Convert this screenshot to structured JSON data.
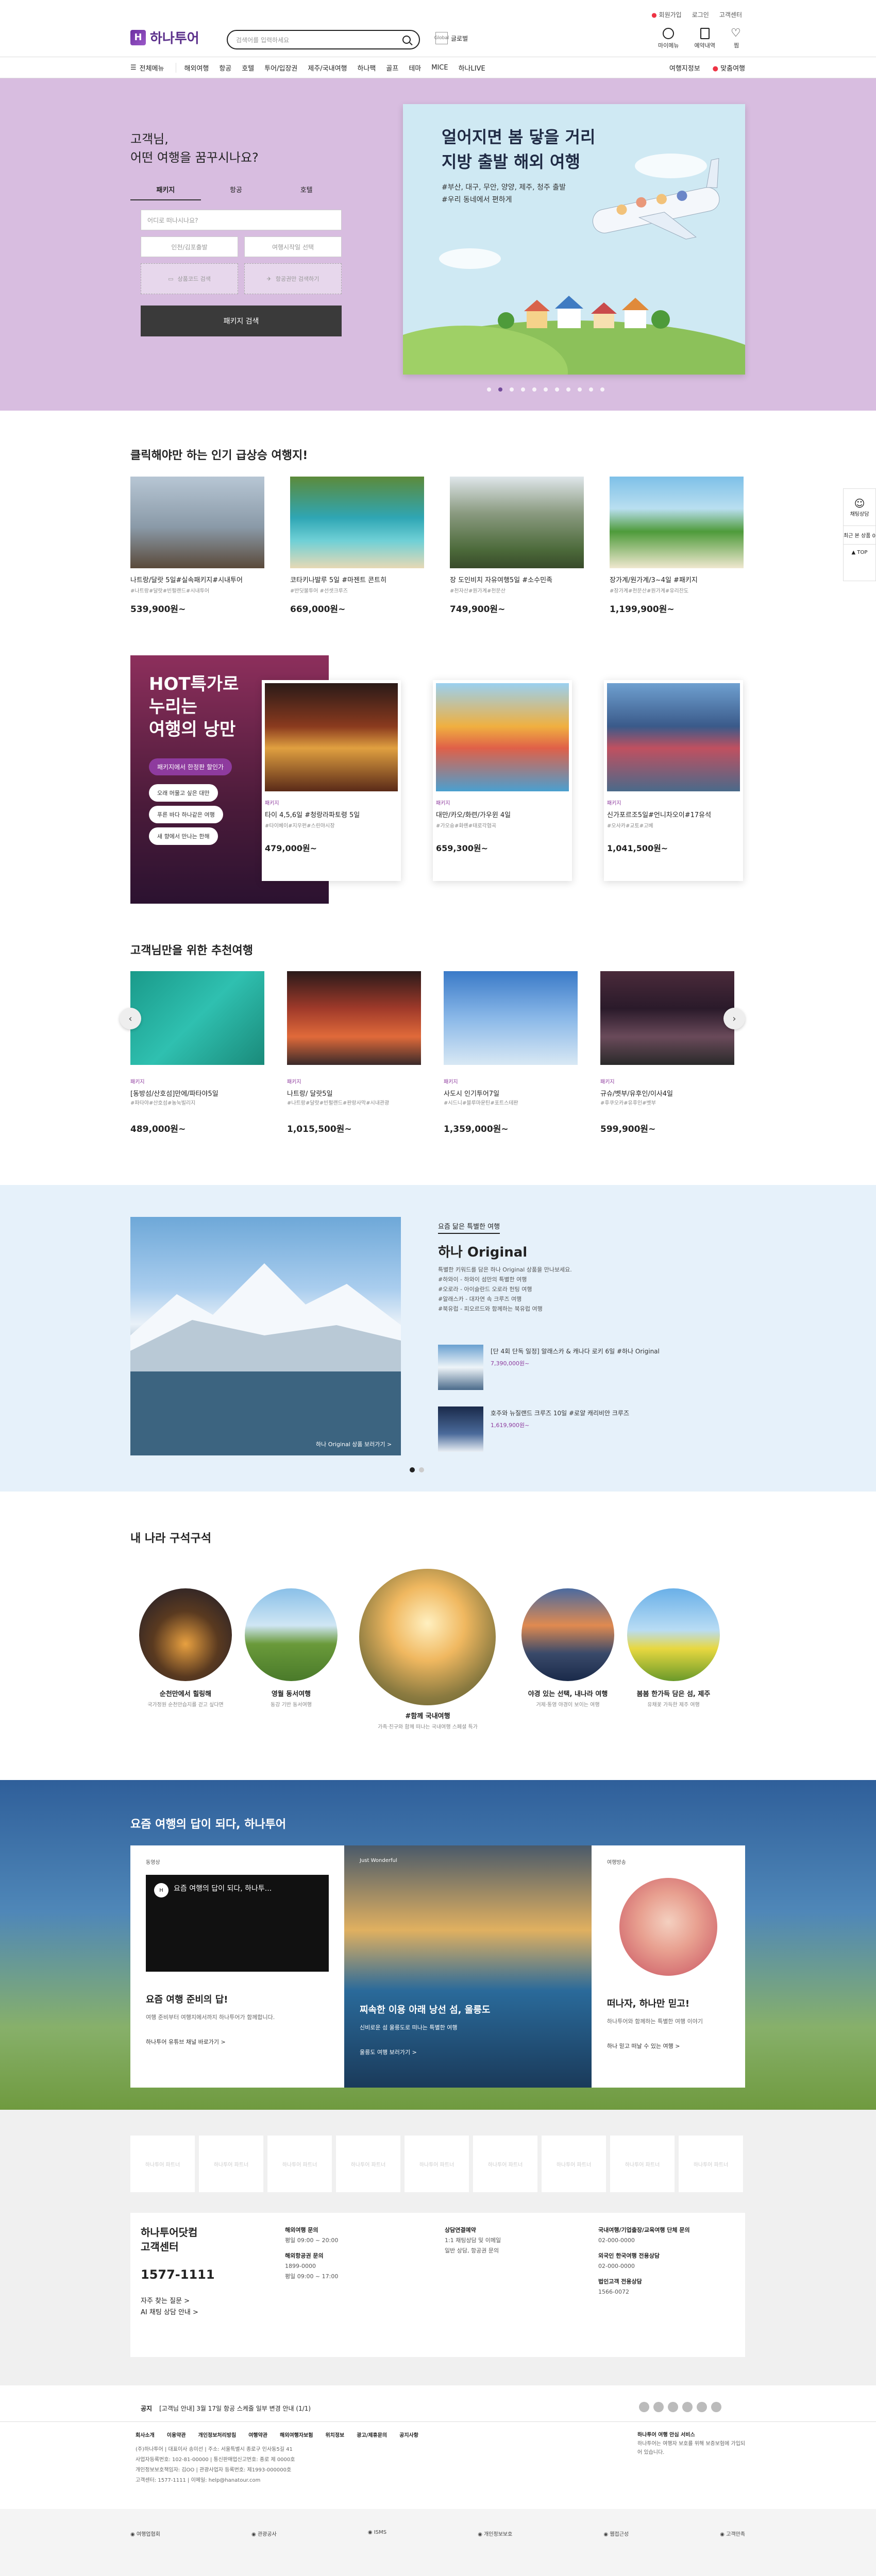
{
  "util": {
    "notice": "회원가입",
    "membership": "로그인",
    "service": "고객센터"
  },
  "header": {
    "logo": "하나투어",
    "search_placeholder": "검색어를 입력하세요",
    "global": "Global",
    "global_label": "글로벌",
    "links": [
      "마이메뉴",
      "예약내역",
      "찜"
    ]
  },
  "gnb": {
    "all": "전체메뉴",
    "items": [
      "해외여행",
      "항공",
      "호텔",
      "투어/입장권",
      "제주/국내여행",
      "하나팩",
      "골프",
      "테마",
      "MICE",
      "하나LIVE"
    ],
    "right": [
      "여행지정보",
      "맞춤여행"
    ]
  },
  "hero": {
    "question1": "고객님,",
    "question2": "어떤 여행을 꿈꾸시나요?",
    "tabs": [
      "패키지",
      "항공",
      "호텔"
    ],
    "dest_placeholder": "어디로 떠나시나요?",
    "depart": "인천/김포출발",
    "date": "여행시작일 선택",
    "filter1": "상품코드 검색",
    "filter2": "항공권만 검색하기",
    "search_btn": "패키지 검색",
    "banner_title1": "얼어지면 봄 닿을 거리",
    "banner_title2": "지방 출발 해외 여행",
    "banner_sub1": "#부산, 대구, 무안, 양양, 제주, 청주 출발",
    "banner_sub2": "#우리 동네에서 편하게"
  },
  "popular": {
    "title": "클릭해야만 하는 인기 급상승 여행지!",
    "items": [
      {
        "name": "나트랑/달랏 5일#실속패키지#시내투어",
        "tags": "#나트랑#달랏#빈펄랜드#시내투어",
        "price": "539,900원~"
      },
      {
        "name": "코타키나발루 5일 #마젠트 콘트히",
        "tags": "#반딧불투어 #선셋크루즈",
        "price": "669,000원~"
      },
      {
        "name": "장 도인비치 자유여행5일 #소수민족",
        "tags": "#천자산#원가계#천문산",
        "price": "749,900원~"
      },
      {
        "name": "장가계/원가계/3~4일 #패키지",
        "tags": "#장가계#천문산#원가계#유리잔도",
        "price": "1,199,900원~"
      }
    ]
  },
  "hot": {
    "title1": "HOT특가로",
    "title2": "누리는",
    "title3": "여행의 낭만",
    "tag": "패키지에서 한정판 할인가",
    "pills": [
      "오래 머물고 싶은 대만",
      "푸른 바다 하나같은 여행",
      "새 향에서 만나는 한해"
    ],
    "cards": [
      {
        "badge": "패키지",
        "name": "타이 4,5,6일 #청랑라파토령 5일",
        "tags": "#타이베이#지우펀#스린야시장",
        "price": "479,000원~"
      },
      {
        "badge": "패키지",
        "name": "대만/카오/화련/가우윈 4일",
        "tags": "#가오슝#화롄#태로각협곡",
        "price": "659,300원~"
      },
      {
        "badge": "패키지",
        "name": "신가포르조5일#언니차오이#17유석",
        "tags": "#오사카#교토#고베",
        "price": "1,041,500원~"
      }
    ]
  },
  "reco": {
    "title": "고객님만을 위한 추천여행",
    "cards": [
      {
        "badge": "패키지",
        "name": "[동방섬/산호섬]만에/파타야5일",
        "tags": "#파타야#산호섬#농눅빌리지",
        "price": "489,000원~"
      },
      {
        "badge": "패키지",
        "name": "나트랑/ 달랏5일",
        "tags": "#나트랑#달랏#빈펄랜드#판랑사막#시내관광",
        "price": "1,015,500원~"
      },
      {
        "badge": "패키지",
        "name": "사도시 인기투어7일",
        "tags": "#시드니#블루마운틴#포트스테판",
        "price": "1,359,000원~"
      },
      {
        "badge": "패키지",
        "name": "규슈/벳부/유후인/이사4일",
        "tags": "#후쿠오카#유후인#벳부",
        "price": "599,900원~"
      }
    ]
  },
  "original": {
    "label": "요즘 닮은 특별한 여행",
    "title": "하나 Original",
    "desc": [
      "특별한 키워드를 담은 하나 Original 상품을 만나보세요.",
      "#하와이 - 하와이 섬만의 특별한 여행",
      "#오로라 - 아이슬란드 오로라 헌팅 여행",
      "#알래스카 - 대자연 속 크루즈 여행",
      "#북유럽 - 피오르드와 함께하는 북유럽 여행"
    ],
    "img_caption": "하나 Original 상품 보러가기 >",
    "items": [
      {
        "text": "[단 4회 단독 일정] 알래스카 & 캐나다 로키 6일 #하나 Original",
        "price": "7,390,000원~"
      },
      {
        "text": "호주와 뉴질랜드 크루즈 10일 #로얄 캐리비안 크루즈",
        "price": "1,619,900원~"
      }
    ]
  },
  "domestic": {
    "title": "내 나라 구석구석",
    "items": [
      {
        "t": "순천만에서 힐링해",
        "s": "국가정원 순천만습지를 걷고 싶다면"
      },
      {
        "t": "영월 동서여행",
        "s": "동강 기반 동서여행"
      },
      {
        "t": "#함께 국내여행",
        "s": "가족·친구와 함께 떠나는 국내여행 스페셜 특가"
      },
      {
        "t": "야경 있는 선택, 내나라 여행",
        "s": "거제·통영 야경이 보이는 여행"
      },
      {
        "t": "봄봄 한가득 담은 섬, 제주",
        "s": "유채꽃 가득한 제주 여행"
      }
    ]
  },
  "story": {
    "title": "요즘 여행의 답이 되다, 하나투어",
    "card1_label": "동영상",
    "card1_video": "요즘 여행의 답이 되다, 하나투...",
    "card1_title": "요즘 여행 준비의 답!",
    "card1_desc": "여행 준비부터 여행지에서까지 하나투어가 함께합니다.",
    "card1_link": "하나투어 유튜브 채널 바로가기 >",
    "card2_label": "Just Wonderful",
    "card2_title": "찌속한 이용 아래 낭선 섬, 울릉도",
    "card2_desc": "신비로운 섬 울릉도로 떠나는 특별한 여행",
    "card2_link": "울릉도 여행 보러가기 >",
    "card3_label": "여행방송",
    "card3_title": "떠나자, 하나만 믿고!",
    "card3_desc": "하나투어와 함께하는 특별한 여행 이야기",
    "card3_link": "하나 믿고 떠날 수 있는 여행 >"
  },
  "partners": [
    "하나투어 파트너",
    "하나투어 파트너",
    "하나투어 파트너",
    "하나투어 파트너",
    "하나투어 파트너",
    "하나투어 파트너",
    "하나투어 파트너",
    "하나투어 파트너",
    "하나투어 파트너"
  ],
  "cs": {
    "title1": "하나투어닷컴",
    "title2": "고객센터",
    "phone": "1577-1111",
    "faq": "자주 찾는 질문 >",
    "chat": "AI 채팅 상담 안내 >",
    "cols": [
      {
        "h": "해외여행 문의",
        "l1": "평일 09:00 ~ 20:00",
        "h2": "해외항공권 문의",
        "l2": "1899-0000",
        "l3": "평일 09:00 ~ 17:00"
      },
      {
        "h": "상담연결예약",
        "l1": "1:1 채팅상담 및 이메일",
        "l2": "일반 상담, 항공권 문의"
      },
      {
        "h": "국내여행/기업출장/교육여행 단체 문의",
        "l1": "02-000-0000",
        "h2": "외국인 한국여행 전용상담",
        "l2": "02-000-0000",
        "h3": "법인고객 전용상담",
        "l3": "1566-0072"
      }
    ]
  },
  "footer": {
    "notice_label": "공지",
    "notice": "[고객님 안내] 3월 17일 항공 스케줄 일부 변경 안내 (1/1)",
    "menu": [
      "회사소개",
      "이용약관",
      "개인정보처리방침",
      "여행약관",
      "해외여행자보험",
      "위치정보",
      "광고/제휴문의",
      "공지사항"
    ],
    "lines": [
      "(주)하나투어 | 대표이사 송미선 | 주소: 서울특별시 종로구 인사동5길 41",
      "사업자등록번호: 102-81-00000 | 통신판매업신고번호: 종로 제 0000호",
      "개인정보보호책임자: 김OO | 관광사업자 등록번호: 제1993-000000호",
      "고객센터: 1577-1111 | 이메일: help@hanatour.com"
    ],
    "right_title": "하나투어 여행 안심 서비스",
    "right_text": "하나투어는 여행자 보호를 위해 보증보험에 가입되어 있습니다.",
    "badges": [
      "여행업협회",
      "관광공사",
      "ISMS",
      "개인정보보호",
      "웹접근성",
      "고객만족"
    ]
  },
  "side": {
    "consult": "채팅상담",
    "recent": "최근 본 상품 0",
    "top": "▲ TOP"
  },
  "colors": {
    "brand": "#5a2e8a",
    "hero_bg": "#d8bde0",
    "accent": "#8e3b9e"
  }
}
